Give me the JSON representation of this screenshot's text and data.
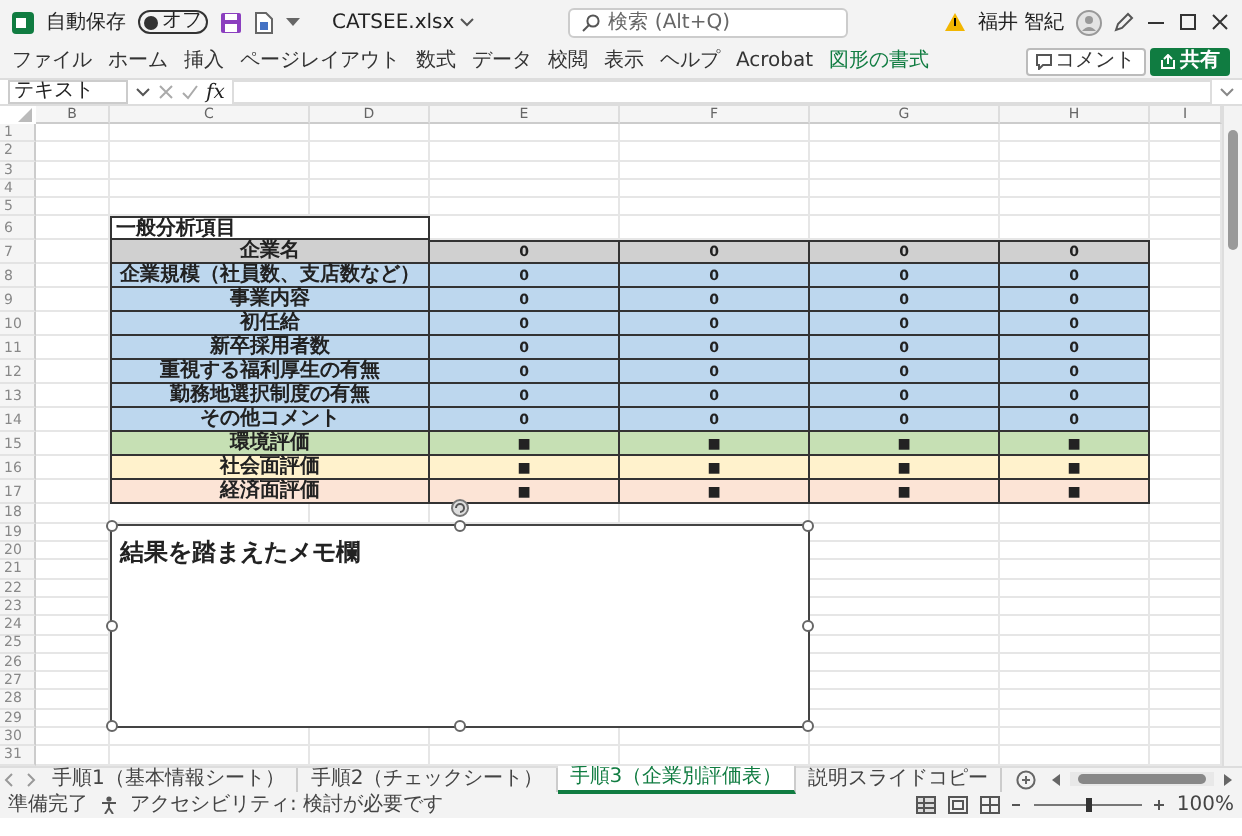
{
  "title_bar": {
    "autosave_label": "自動保存",
    "autosave_on": false,
    "autosave_state": "オフ",
    "filename": "CATSEE.xlsx",
    "search_placeholder": "検索 (Alt+Q)",
    "user_name": "福井 智紀"
  },
  "ribbon_tabs": [
    {
      "label": "ファイル",
      "kind": "tab"
    },
    {
      "label": "ホーム",
      "kind": "tab"
    },
    {
      "label": "挿入",
      "kind": "tab"
    },
    {
      "label": "ページレイアウト",
      "kind": "tab"
    },
    {
      "label": "数式",
      "kind": "tab"
    },
    {
      "label": "データ",
      "kind": "tab"
    },
    {
      "label": "校閲",
      "kind": "tab"
    },
    {
      "label": "表示",
      "kind": "tab"
    },
    {
      "label": "ヘルプ",
      "kind": "tab"
    },
    {
      "label": "Acrobat",
      "kind": "tab"
    },
    {
      "label": "図形の書式",
      "kind": "contextual"
    }
  ],
  "ribbon_buttons": [
    {
      "label": "コメント",
      "kind": "outline"
    },
    {
      "label": "共有",
      "kind": "primary"
    }
  ],
  "formula_bar": {
    "name_box": "テキスト",
    "fx": "fx"
  },
  "columns": [
    "B",
    "C",
    "D",
    "E",
    "F",
    "G",
    "H",
    "I"
  ],
  "rows": [
    "1",
    "2",
    "3",
    "4",
    "5",
    "6",
    "7",
    "8",
    "9",
    "10",
    "11",
    "12",
    "13",
    "14",
    "15",
    "16",
    "17",
    "18",
    "19",
    "20",
    "21",
    "22",
    "23",
    "24",
    "25",
    "26",
    "27",
    "28",
    "29",
    "30",
    "31"
  ],
  "table": {
    "title": "一般分析項目",
    "rows": [
      {
        "label": "企業名",
        "color": "#d0d0d0",
        "values": [
          "0",
          "0",
          "0",
          "0"
        ]
      },
      {
        "label": "企業規模（社員数、支店数など）",
        "color": "#bdd7ee",
        "values": [
          "0",
          "0",
          "0",
          "0"
        ]
      },
      {
        "label": "事業内容",
        "color": "#bdd7ee",
        "values": [
          "0",
          "0",
          "0",
          "0"
        ]
      },
      {
        "label": "初任給",
        "color": "#bdd7ee",
        "values": [
          "0",
          "0",
          "0",
          "0"
        ]
      },
      {
        "label": "新卒採用者数",
        "color": "#bdd7ee",
        "values": [
          "0",
          "0",
          "0",
          "0"
        ]
      },
      {
        "label": "重視する福利厚生の有無",
        "color": "#bdd7ee",
        "values": [
          "0",
          "0",
          "0",
          "0"
        ]
      },
      {
        "label": "勤務地選択制度の有無",
        "color": "#bdd7ee",
        "values": [
          "0",
          "0",
          "0",
          "0"
        ]
      },
      {
        "label": "その他コメント",
        "color": "#bdd7ee",
        "values": [
          "0",
          "0",
          "0",
          "0"
        ]
      },
      {
        "label": "環境評価",
        "color": "#c6e0b4",
        "values": [
          "■",
          "■",
          "■",
          "■"
        ]
      },
      {
        "label": "社会面評価",
        "color": "#fff2cc",
        "values": [
          "■",
          "■",
          "■",
          "■"
        ]
      },
      {
        "label": "経済面評価",
        "color": "#fce4d6",
        "values": [
          "■",
          "■",
          "■",
          "■"
        ]
      }
    ]
  },
  "memo": {
    "text": "結果を踏まえたメモ欄",
    "selected": true
  },
  "sheet_tabs": [
    {
      "label": "手順1（基本情報シート）",
      "selected": false
    },
    {
      "label": "手順2（チェックシート）",
      "selected": false
    },
    {
      "label": "手順3（企業別評価表）",
      "selected": true
    },
    {
      "label": "説明スライドコピー",
      "selected": false
    }
  ],
  "status_bar": {
    "ready": "準備完了",
    "accessibility": "アクセシビリティ: 検討が必要です",
    "zoom": "100%",
    "zoom_slider": {
      "level": 0.5
    }
  }
}
